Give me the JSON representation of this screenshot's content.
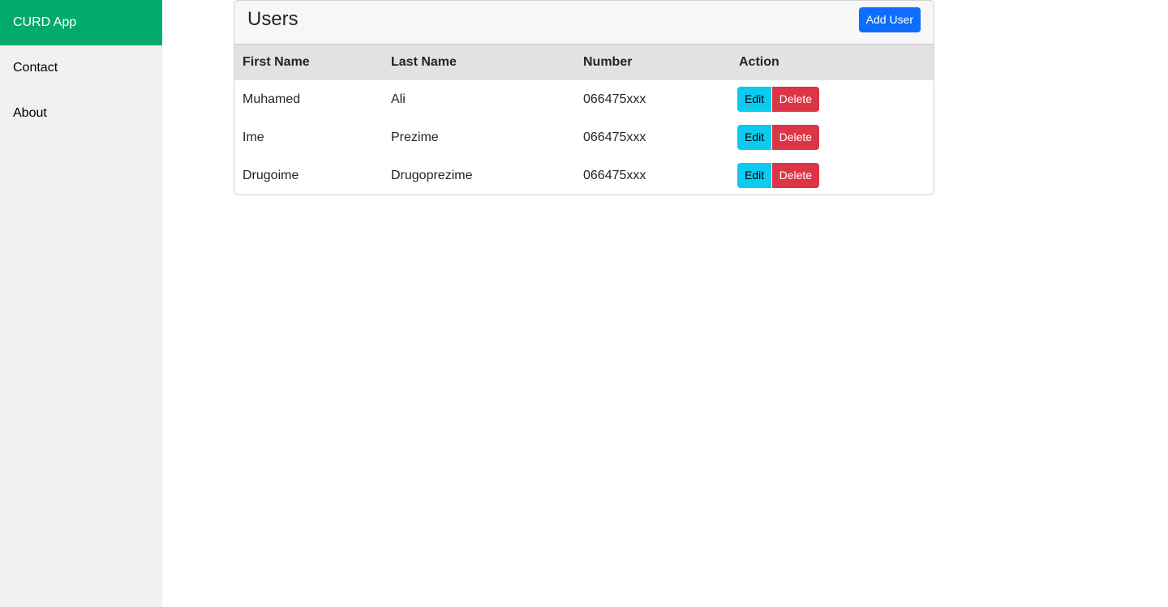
{
  "sidebar": {
    "items": [
      {
        "label": "CURD App"
      },
      {
        "label": "Contact"
      },
      {
        "label": "About"
      }
    ]
  },
  "card": {
    "title": "Users",
    "add_button_label": "Add User"
  },
  "table": {
    "headers": [
      "First Name",
      "Last Name",
      "Number",
      "Action"
    ],
    "rows": [
      {
        "first": "Muhamed",
        "last": "Ali",
        "number": "066475xxx"
      },
      {
        "first": "Ime",
        "last": "Prezime",
        "number": "066475xxx"
      },
      {
        "first": "Drugoime",
        "last": "Drugoprezime",
        "number": "066475xxx"
      }
    ],
    "edit_label": "Edit",
    "delete_label": "Delete"
  },
  "colors": {
    "active": "#04aa6d",
    "primary": "#0d6efd",
    "info": "#0dcaf0",
    "danger": "#dc3545"
  }
}
